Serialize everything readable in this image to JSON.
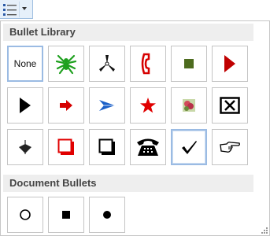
{
  "toolbar": {
    "button_icon": "bullets-list-icon"
  },
  "bullet_library": {
    "header": "Bullet Library",
    "none_label": "None",
    "items": [
      "none",
      "spider-icon",
      "three-blade-icon",
      "telephone-handset-icon",
      "square-bullet-icon",
      "play-triangle-icon",
      "black-triangle-icon",
      "red-arrow-icon",
      "blue-arrowhead-icon",
      "red-star-icon",
      "flower-picture-icon",
      "boxed-x-icon",
      "down-arrowhead-icon",
      "red-shadow-box-icon",
      "black-shadow-box-icon",
      "desk-phone-icon",
      "checkmark-icon",
      "pointing-hand-icon"
    ],
    "selected_index": 16
  },
  "document_bullets": {
    "header": "Document Bullets",
    "items": [
      "hollow-circle-icon",
      "filled-square-icon",
      "filled-circle-icon"
    ]
  },
  "colors": {
    "accent": "#9bbbe3",
    "header_bg": "#eeeeee",
    "red": "#d60000",
    "green": "#1ea01e",
    "blue": "#1a5fc8",
    "olive": "#4d6b1e"
  }
}
